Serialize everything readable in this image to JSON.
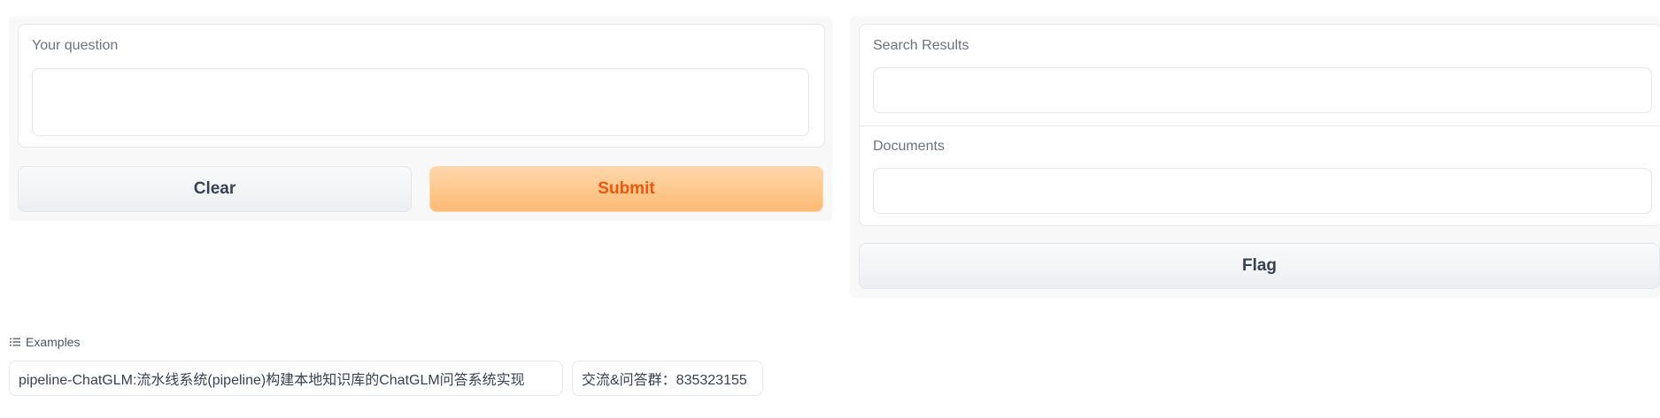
{
  "question": {
    "label": "Your question",
    "value": ""
  },
  "buttons": {
    "clear": "Clear",
    "submit": "Submit",
    "flag": "Flag"
  },
  "outputs": {
    "search_results_label": "Search Results",
    "search_results_value": "",
    "documents_label": "Documents",
    "documents_value": ""
  },
  "examples": {
    "header": "Examples",
    "items": [
      "pipeline-ChatGLM:流水线系统(pipeline)构建本地知识库的ChatGLM问答系统实现",
      "交流&问答群：835323155"
    ]
  },
  "colors": {
    "primary_text": "#ea580c",
    "primary_bg": "#fdba74",
    "panel_bg": "#f8f8f9"
  }
}
